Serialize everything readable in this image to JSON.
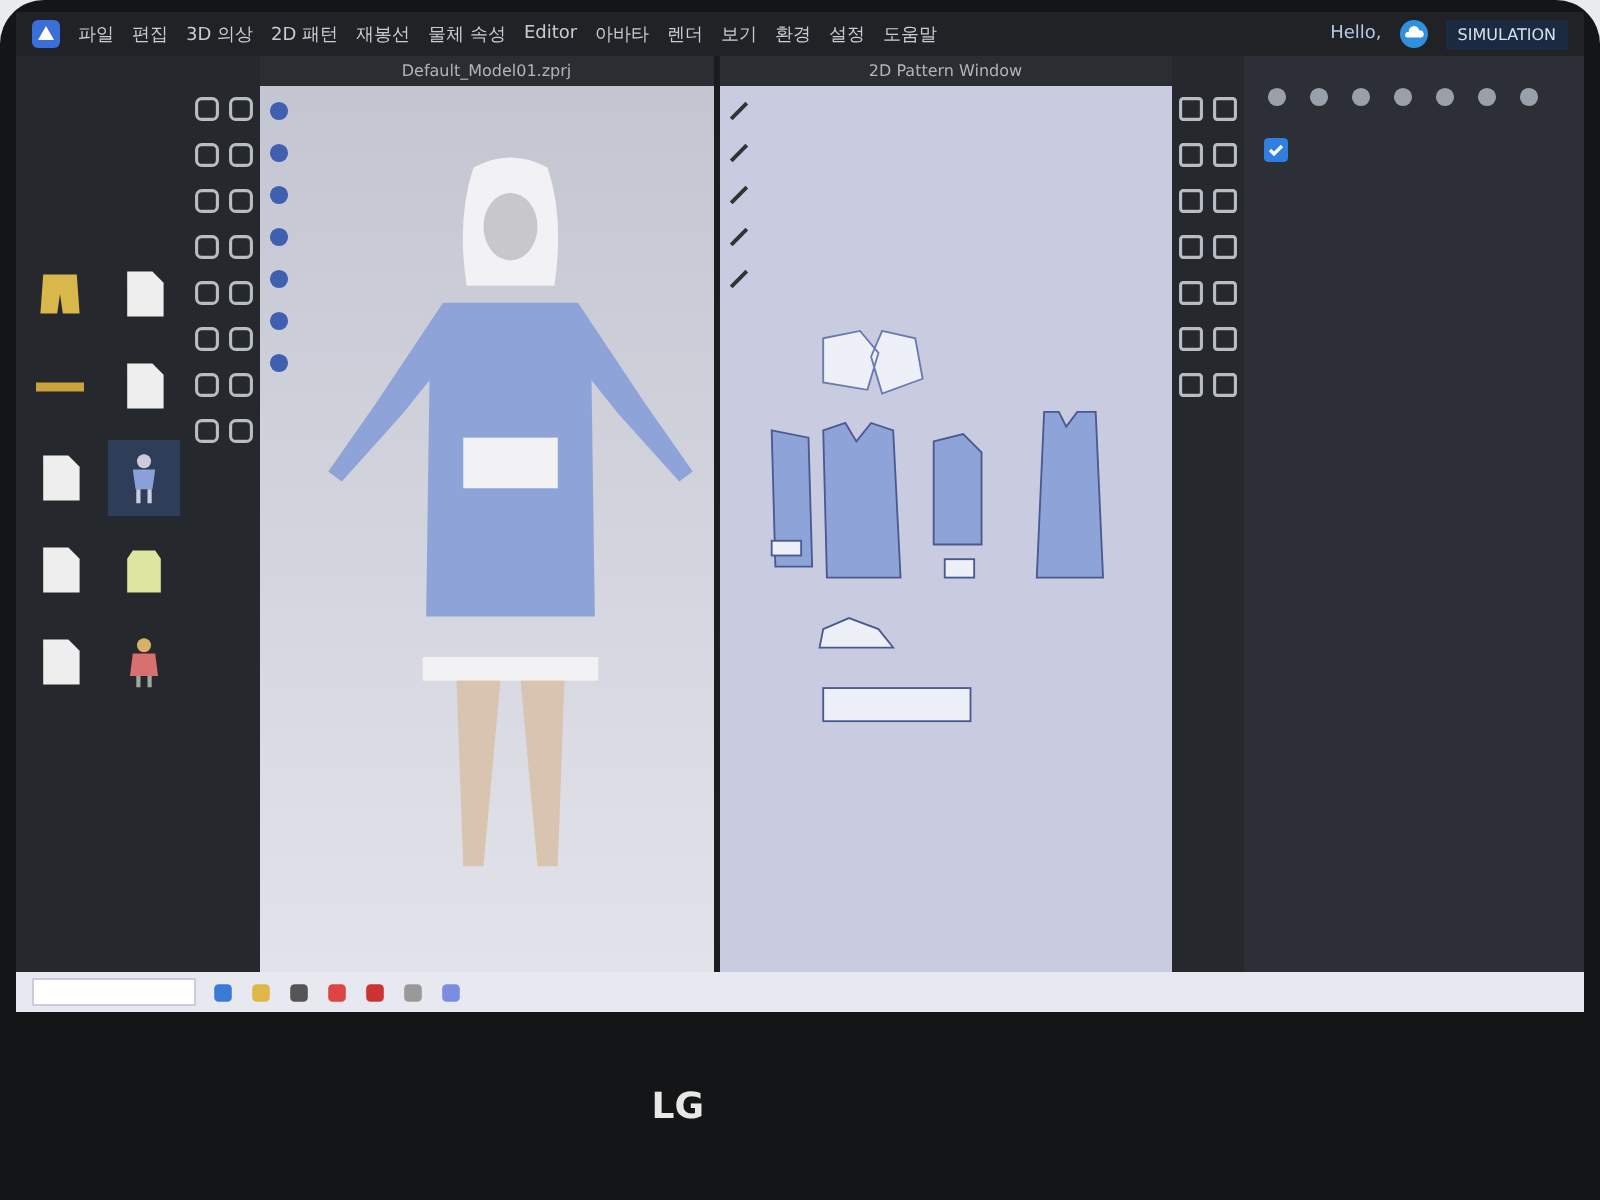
{
  "menu": [
    "파일",
    "편집",
    "3D 의상",
    "2D 패턴",
    "재봉선",
    "물체 속성",
    "Editor",
    "아바타",
    "렌더",
    "보기",
    "환경",
    "설정",
    "도움말"
  ],
  "library": {
    "items": [
      {
        "kind": "garment",
        "selected": false
      },
      {
        "kind": "file",
        "selected": false
      },
      {
        "kind": "accessory",
        "selected": false
      },
      {
        "kind": "file",
        "selected": false
      },
      {
        "kind": "file",
        "selected": false
      },
      {
        "kind": "avatar",
        "selected": true
      },
      {
        "kind": "file",
        "selected": false
      },
      {
        "kind": "top",
        "selected": false
      },
      {
        "kind": "file",
        "selected": false
      },
      {
        "kind": "figure",
        "selected": false
      }
    ]
  },
  "viewport_3d": {
    "title": "Default_Model01.zprj"
  },
  "pattern_window": {
    "title": "2D Pattern Window"
  },
  "account": {
    "greeting": "Hello,"
  },
  "mode": {
    "label": "SIMULATION"
  },
  "property_panel": {
    "checked": true
  },
  "bezel": {
    "brand": "LG"
  }
}
